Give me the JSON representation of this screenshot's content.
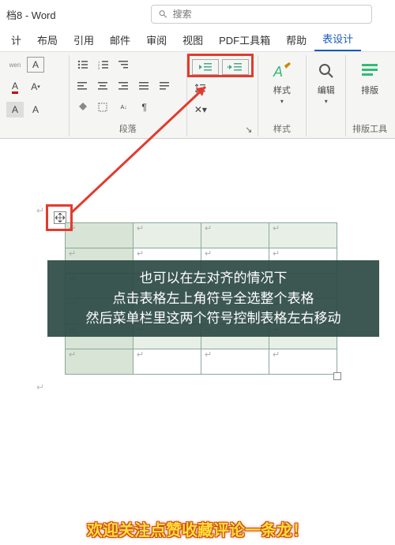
{
  "titlebar": {
    "title": "档8 - Word"
  },
  "search": {
    "placeholder": "搜索"
  },
  "tabs": [
    "计",
    "布局",
    "引用",
    "邮件",
    "审阅",
    "视图",
    "PDF工具箱",
    "帮助",
    "表设计"
  ],
  "active_tab_index": 8,
  "ribbon": {
    "font": {
      "wen": "wen",
      "A_box": "A",
      "A_caret": "A",
      "A_fill": "A"
    },
    "paragraph": {
      "label": "段落"
    },
    "indent": {
      "dec": "⇤",
      "inc": "⇥"
    },
    "styles": {
      "label": "样式",
      "group_label": "样式"
    },
    "edit": {
      "label": "编辑"
    },
    "layout": {
      "label": "排版工具",
      "btn": "排版"
    }
  },
  "table": {
    "rows": 6,
    "cols": 4,
    "cell_mark": "↵"
  },
  "overlay": {
    "line1": "也可以在左对齐的情况下",
    "line2": "点击表格左上角符号全选整个表格",
    "line3": "然后菜单栏里这两个符号控制表格左右移动"
  },
  "footer": "欢迎关注点赞收藏评论一条龙！"
}
